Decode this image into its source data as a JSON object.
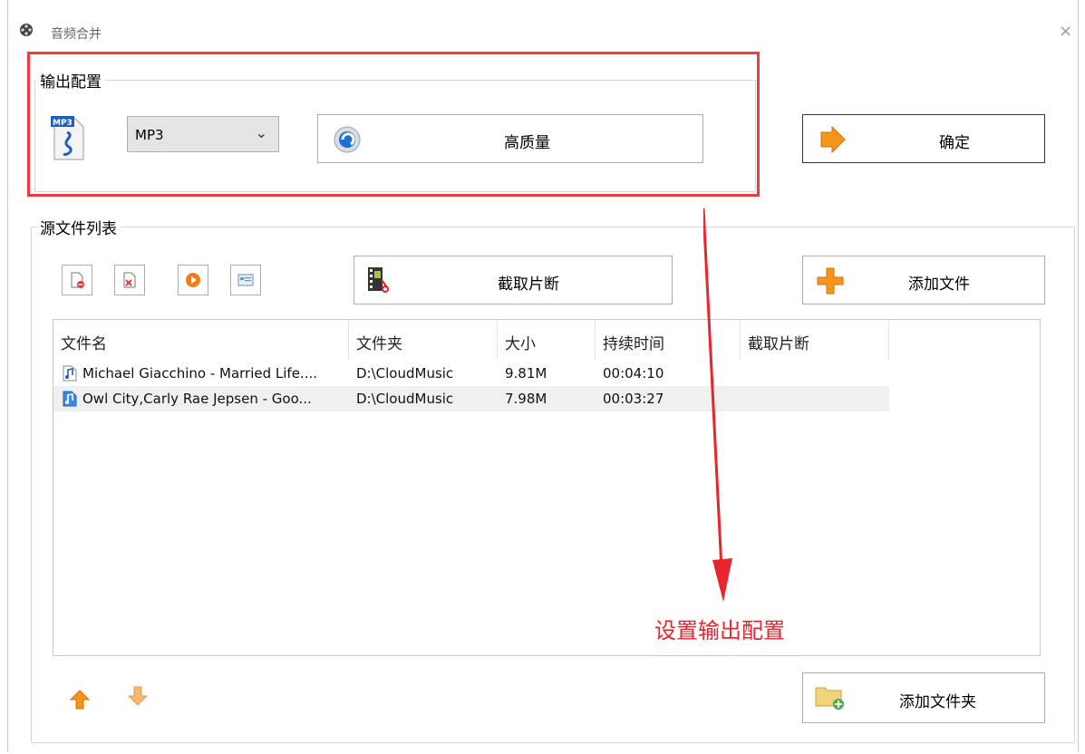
{
  "window": {
    "title": "音频合并",
    "close_glyph": "×"
  },
  "output_config": {
    "group_label": "输出配置",
    "format_icon": "mp3-file-icon",
    "format_value": "MP3",
    "quality_label": "高质量",
    "confirm_label": "确定"
  },
  "source_files": {
    "group_label": "源文件列表",
    "clip_button_label": "截取片断",
    "add_file_label": "添加文件",
    "add_folder_label": "添加文件夹",
    "columns": [
      "文件名",
      "文件夹",
      "大小",
      "持续时间",
      "截取片断"
    ],
    "rows": [
      {
        "name": "Michael Giacchino - Married Life....",
        "folder": "D:\\CloudMusic",
        "size": "9.81M",
        "duration": "00:04:10",
        "clip": "",
        "selected": false
      },
      {
        "name": "Owl City,Carly Rae Jepsen - Goo...",
        "folder": "D:\\CloudMusic",
        "size": "7.98M",
        "duration": "00:03:27",
        "clip": "",
        "selected": true
      }
    ]
  },
  "annotation": {
    "text": "设置输出配置",
    "color": "#e8242c"
  },
  "colors": {
    "highlight_box": "#f23a3a",
    "accent_orange": "#f7941d"
  }
}
